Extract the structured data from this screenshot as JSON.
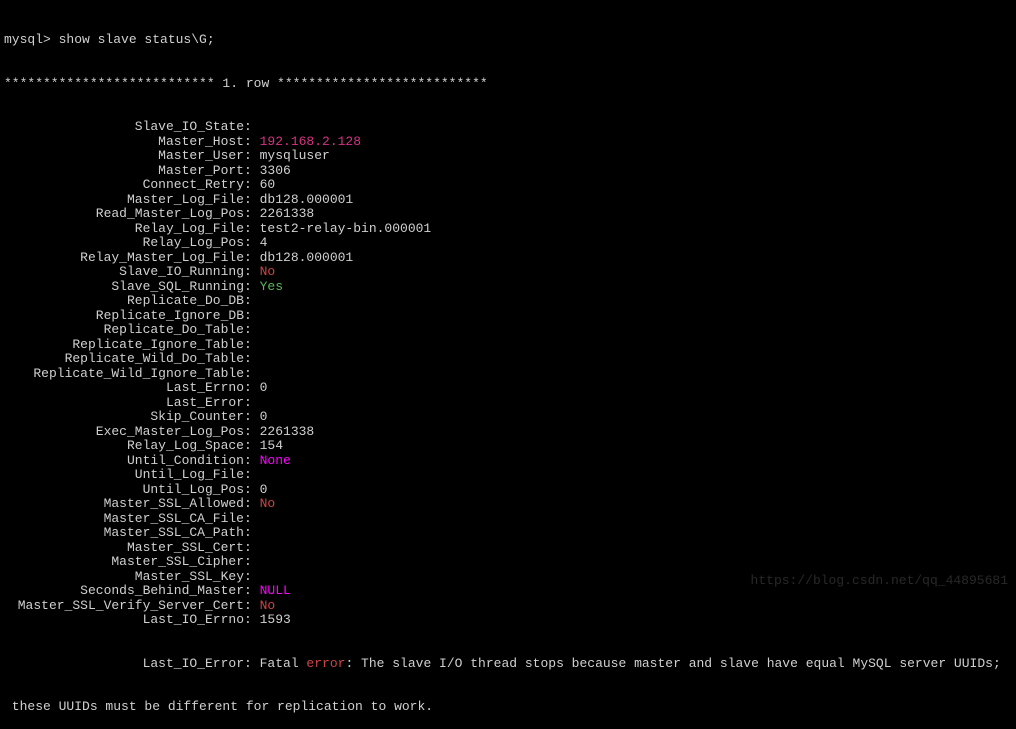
{
  "prompt": "mysql> show slave status\\G;",
  "rowHeader": "*************************** 1. row ***************************",
  "fields": [
    {
      "label": "Slave_IO_State",
      "value": "",
      "cls": ""
    },
    {
      "label": "Master_Host",
      "value": "192.168.2.128",
      "cls": "val-magenta"
    },
    {
      "label": "Master_User",
      "value": "mysqluser",
      "cls": ""
    },
    {
      "label": "Master_Port",
      "value": "3306",
      "cls": ""
    },
    {
      "label": "Connect_Retry",
      "value": "60",
      "cls": ""
    },
    {
      "label": "Master_Log_File",
      "value": "db128.000001",
      "cls": ""
    },
    {
      "label": "Read_Master_Log_Pos",
      "value": "2261338",
      "cls": ""
    },
    {
      "label": "Relay_Log_File",
      "value": "test2-relay-bin.000001",
      "cls": ""
    },
    {
      "label": "Relay_Log_Pos",
      "value": "4",
      "cls": ""
    },
    {
      "label": "Relay_Master_Log_File",
      "value": "db128.000001",
      "cls": ""
    },
    {
      "label": "Slave_IO_Running",
      "value": "No",
      "cls": "val-red"
    },
    {
      "label": "Slave_SQL_Running",
      "value": "Yes",
      "cls": "val-green"
    },
    {
      "label": "Replicate_Do_DB",
      "value": "",
      "cls": ""
    },
    {
      "label": "Replicate_Ignore_DB",
      "value": "",
      "cls": ""
    },
    {
      "label": "Replicate_Do_Table",
      "value": "",
      "cls": ""
    },
    {
      "label": "Replicate_Ignore_Table",
      "value": "",
      "cls": ""
    },
    {
      "label": "Replicate_Wild_Do_Table",
      "value": "",
      "cls": ""
    },
    {
      "label": "Replicate_Wild_Ignore_Table",
      "value": "",
      "cls": ""
    },
    {
      "label": "Last_Errno",
      "value": "0",
      "cls": ""
    },
    {
      "label": "Last_Error",
      "value": "",
      "cls": ""
    },
    {
      "label": "Skip_Counter",
      "value": "0",
      "cls": ""
    },
    {
      "label": "Exec_Master_Log_Pos",
      "value": "2261338",
      "cls": ""
    },
    {
      "label": "Relay_Log_Space",
      "value": "154",
      "cls": ""
    },
    {
      "label": "Until_Condition",
      "value": "None",
      "cls": "val-bright-magenta"
    },
    {
      "label": "Until_Log_File",
      "value": "",
      "cls": ""
    },
    {
      "label": "Until_Log_Pos",
      "value": "0",
      "cls": ""
    },
    {
      "label": "Master_SSL_Allowed",
      "value": "No",
      "cls": "val-red"
    },
    {
      "label": "Master_SSL_CA_File",
      "value": "",
      "cls": ""
    },
    {
      "label": "Master_SSL_CA_Path",
      "value": "",
      "cls": ""
    },
    {
      "label": "Master_SSL_Cert",
      "value": "",
      "cls": ""
    },
    {
      "label": "Master_SSL_Cipher",
      "value": "",
      "cls": ""
    },
    {
      "label": "Master_SSL_Key",
      "value": "",
      "cls": ""
    },
    {
      "label": "Seconds_Behind_Master",
      "value": "NULL",
      "cls": "val-bright-magenta"
    },
    {
      "label": "Master_SSL_Verify_Server_Cert",
      "value": "No",
      "cls": "val-red"
    },
    {
      "label": "Last_IO_Errno",
      "value": "1593",
      "cls": ""
    }
  ],
  "lastIoError": {
    "label": "Last_IO_Error",
    "prefix": "Fatal ",
    "errorWord": "error",
    "middle": ": The slave I/O thread stops because master and slave have equal MySQL server UUIDs;",
    "continuation": " these UUIDs must be different for replication to work."
  },
  "watermark": "https://blog.csdn.net/qq_44895681"
}
